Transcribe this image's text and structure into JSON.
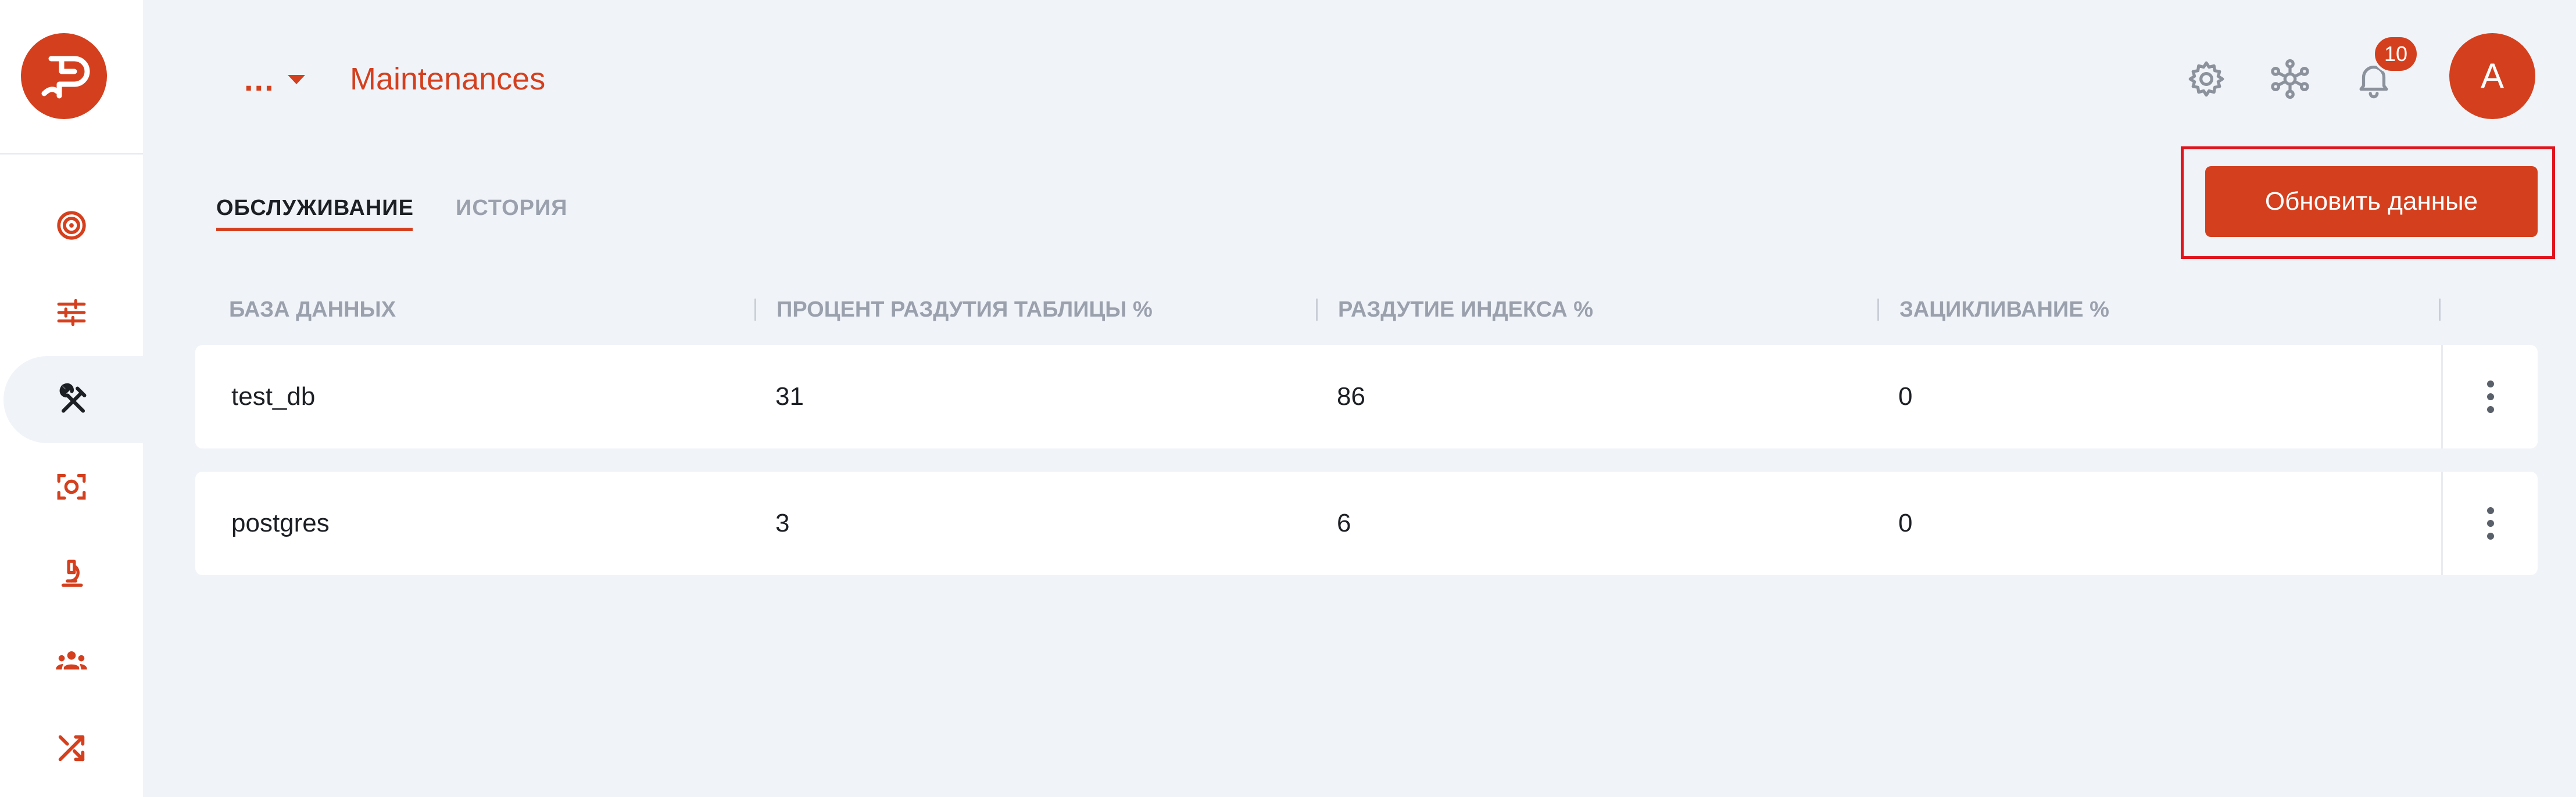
{
  "header": {
    "breadcrumb_dots": "...",
    "title": "Maintenances",
    "notification_count": "10",
    "avatar_initial": "A"
  },
  "sidebar": {
    "items": [
      {
        "icon": "target-icon"
      },
      {
        "icon": "sliders-icon"
      },
      {
        "icon": "tools-icon",
        "active": true
      },
      {
        "icon": "scan-icon"
      },
      {
        "icon": "microscope-icon"
      },
      {
        "icon": "users-icon"
      },
      {
        "icon": "shuffle-icon"
      }
    ]
  },
  "tabs": [
    {
      "label": "ОБСЛУЖИВАНИЕ",
      "active": true
    },
    {
      "label": "ИСТОРИЯ",
      "active": false
    }
  ],
  "actions": {
    "refresh_label": "Обновить данные"
  },
  "table": {
    "columns": [
      "БАЗА ДАННЫХ",
      "ПРОЦЕНТ РАЗДУТИЯ ТАБЛИЦЫ %",
      "РАЗДУТИЕ ИНДЕКСА %",
      "ЗАЦИКЛИВАНИЕ %"
    ],
    "rows": [
      {
        "database": "test_db",
        "table_bloat": "31",
        "index_bloat": "86",
        "wraparound": "0"
      },
      {
        "database": "postgres",
        "table_bloat": "3",
        "index_bloat": "6",
        "wraparound": "0"
      }
    ]
  },
  "colors": {
    "accent": "#d4401e",
    "background": "#f0f3f8",
    "highlight": "#e0141d"
  }
}
